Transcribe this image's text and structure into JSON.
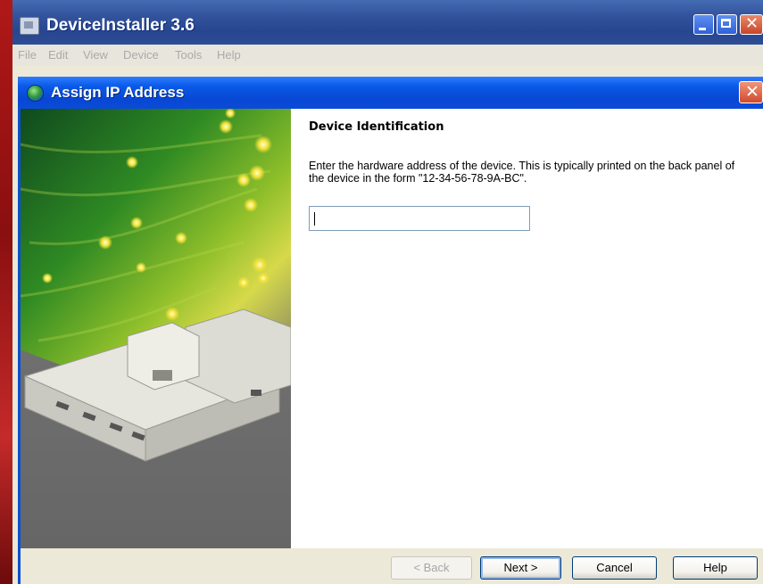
{
  "main_window": {
    "title": "DeviceInstaller 3.6",
    "menu": [
      "File",
      "Edit",
      "View",
      "Device",
      "Tools",
      "Help"
    ]
  },
  "dialog": {
    "title": "Assign IP Address",
    "section_title": "Device Identification",
    "instructions": "Enter the hardware address of the device.  This is typically printed on the back panel of the device in the form \"12-34-56-78-9A-BC\".",
    "hardware_address_value": "",
    "buttons": {
      "back": "< Back",
      "next": "Next >",
      "cancel": "Cancel",
      "help": "Help"
    }
  },
  "colors": {
    "title_bar_blue": "#0a4bd8",
    "dialog_face": "#ece9d8",
    "close_button": "#d04a2e"
  }
}
